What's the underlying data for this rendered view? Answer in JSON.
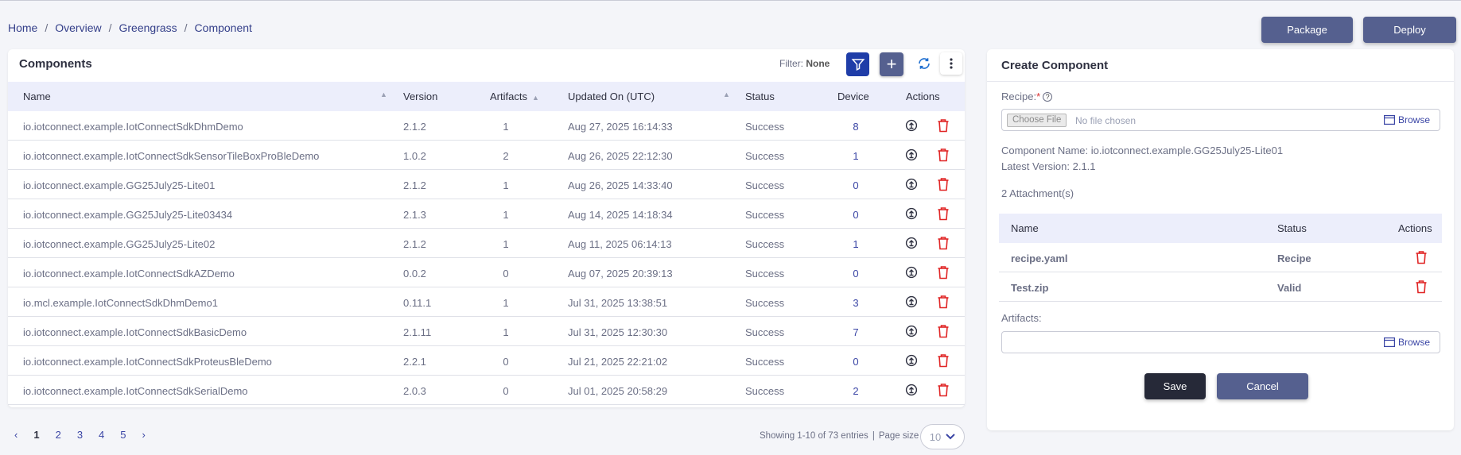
{
  "breadcrumb": [
    "Home",
    "Overview",
    "Greengrass",
    "Component"
  ],
  "top_buttons": {
    "package": "Package",
    "deploy": "Deploy"
  },
  "components": {
    "title": "Components",
    "filter_label": "Filter:",
    "filter_value": "None",
    "columns": [
      "Name",
      "Version",
      "Artifacts",
      "Updated On (UTC)",
      "Status",
      "Device",
      "Actions"
    ],
    "rows": [
      {
        "name": "io.iotconnect.example.IotConnectSdkDhmDemo",
        "version": "2.1.2",
        "artifacts": "1",
        "updated": "Aug 27, 2025 16:14:33",
        "status": "Success",
        "device": "8"
      },
      {
        "name": "io.iotconnect.example.IotConnectSdkSensorTileBoxProBleDemo",
        "version": "1.0.2",
        "artifacts": "2",
        "updated": "Aug 26, 2025 22:12:30",
        "status": "Success",
        "device": "1"
      },
      {
        "name": "io.iotconnect.example.GG25July25-Lite01",
        "version": "2.1.2",
        "artifacts": "1",
        "updated": "Aug 26, 2025 14:33:40",
        "status": "Success",
        "device": "0"
      },
      {
        "name": "io.iotconnect.example.GG25July25-Lite03434",
        "version": "2.1.3",
        "artifacts": "1",
        "updated": "Aug 14, 2025 14:18:34",
        "status": "Success",
        "device": "0"
      },
      {
        "name": "io.iotconnect.example.GG25July25-Lite02",
        "version": "2.1.2",
        "artifacts": "1",
        "updated": "Aug 11, 2025 06:14:13",
        "status": "Success",
        "device": "1"
      },
      {
        "name": "io.iotconnect.example.IotConnectSdkAZDemo",
        "version": "0.0.2",
        "artifacts": "0",
        "updated": "Aug 07, 2025 20:39:13",
        "status": "Success",
        "device": "0"
      },
      {
        "name": "io.mcl.example.IotConnectSdkDhmDemo1",
        "version": "0.11.1",
        "artifacts": "1",
        "updated": "Jul 31, 2025 13:38:51",
        "status": "Success",
        "device": "3"
      },
      {
        "name": "io.iotconnect.example.IotConnectSdkBasicDemo",
        "version": "2.1.11",
        "artifacts": "1",
        "updated": "Jul 31, 2025 12:30:30",
        "status": "Success",
        "device": "7"
      },
      {
        "name": "io.iotconnect.example.IotConnectSdkProteusBleDemo",
        "version": "2.2.1",
        "artifacts": "0",
        "updated": "Jul 21, 2025 22:21:02",
        "status": "Success",
        "device": "0"
      },
      {
        "name": "io.iotconnect.example.IotConnectSdkSerialDemo",
        "version": "2.0.3",
        "artifacts": "0",
        "updated": "Jul 01, 2025 20:58:29",
        "status": "Success",
        "device": "2"
      }
    ]
  },
  "pagination": {
    "prev": "‹",
    "pages": [
      "1",
      "2",
      "3",
      "4",
      "5"
    ],
    "current_page": "1",
    "next": "›",
    "showing": "Showing 1-10 of 73 entries",
    "page_size_label": "Page size",
    "page_size": "10"
  },
  "create": {
    "title": "Create Component",
    "recipe_label": "Recipe:",
    "required_mark": "*",
    "help": "?",
    "choose_file": "Choose File",
    "no_file": "No file chosen",
    "browse": "Browse",
    "component_name": "Component Name: io.iotconnect.example.GG25July25-Lite01",
    "latest_version": "Latest Version: 2.1.1",
    "attachments_count": "2 Attachment(s)",
    "att_columns": [
      "Name",
      "Status",
      "Actions"
    ],
    "attachments": [
      {
        "name": "recipe.yaml",
        "status": "Recipe"
      },
      {
        "name": "Test.zip",
        "status": "Valid"
      }
    ],
    "artifacts_label": "Artifacts:",
    "save": "Save",
    "cancel": "Cancel"
  },
  "colors": {
    "accent": "#55608f",
    "filter_active": "#1f3da8",
    "header_bg": "#eceefb",
    "delete_red": "#e02424",
    "link_blue": "#3a45a5"
  }
}
